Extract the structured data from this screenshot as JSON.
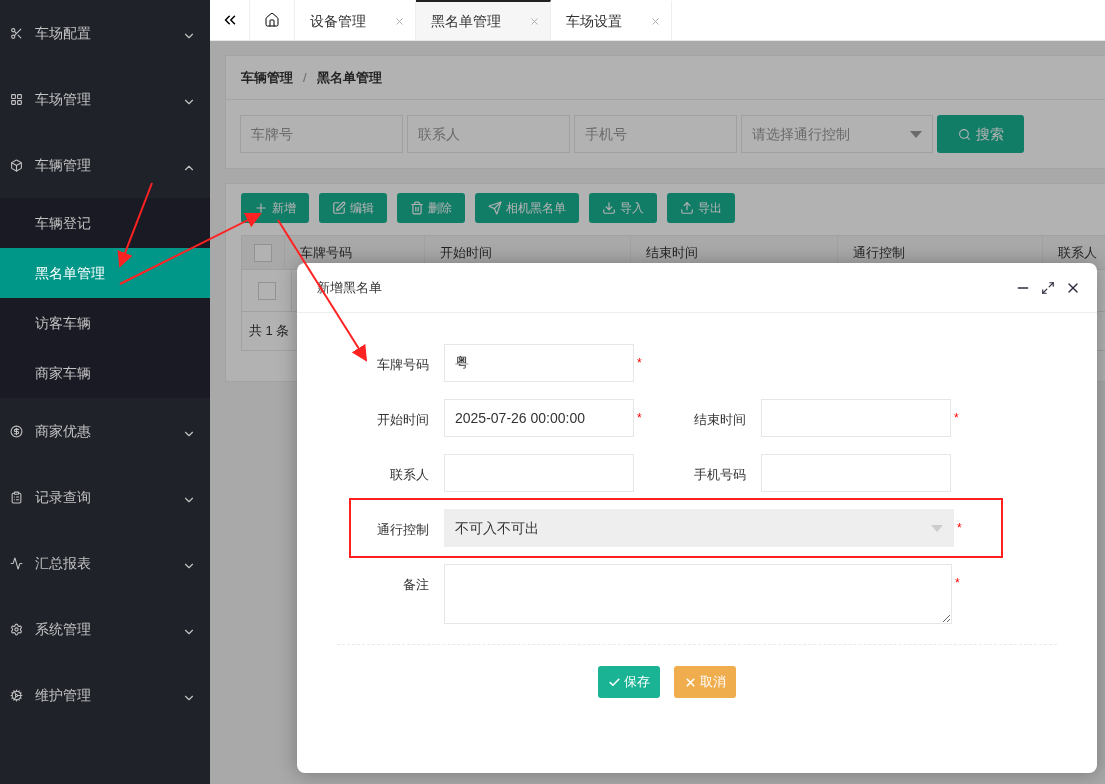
{
  "sidebar": {
    "items": [
      {
        "label": "车场配置",
        "expanded": false
      },
      {
        "label": "车场管理",
        "expanded": false
      },
      {
        "label": "车辆管理",
        "expanded": true,
        "children": [
          {
            "label": "车辆登记",
            "selected": false
          },
          {
            "label": "黑名单管理",
            "selected": true
          },
          {
            "label": "访客车辆",
            "selected": false
          },
          {
            "label": "商家车辆",
            "selected": false
          }
        ]
      },
      {
        "label": "商家优惠",
        "expanded": false
      },
      {
        "label": "记录查询",
        "expanded": false
      },
      {
        "label": "汇总报表",
        "expanded": false
      },
      {
        "label": "系统管理",
        "expanded": false
      },
      {
        "label": "维护管理",
        "expanded": false
      }
    ]
  },
  "tabs": [
    {
      "label": "设备管理",
      "selected": false
    },
    {
      "label": "黑名单管理",
      "selected": true
    },
    {
      "label": "车场设置",
      "selected": false
    }
  ],
  "breadcrumb": {
    "items": [
      "车辆管理",
      "黑名单管理"
    ],
    "separator": "/"
  },
  "search": {
    "fields": [
      {
        "placeholder": "车牌号"
      },
      {
        "placeholder": "联系人"
      },
      {
        "placeholder": "手机号"
      }
    ],
    "select_placeholder": "请选择通行控制",
    "button": "搜索"
  },
  "toolbar": [
    "新增",
    "编辑",
    "删除",
    "相机黑名单",
    "导入",
    "导出"
  ],
  "table": {
    "columns": [
      "车牌号码",
      "开始时间",
      "结束时间",
      "通行控制",
      "联系人"
    ],
    "header_checked": false,
    "rows": [
      {
        "checked": false
      }
    ],
    "footer": "共 1 条"
  },
  "modal": {
    "title": "新增黑名单",
    "required_mark": "*",
    "rows": [
      [
        {
          "label": "车牌号码",
          "kind": "text",
          "value": "粤",
          "required": true
        }
      ],
      [
        {
          "label": "开始时间",
          "kind": "text",
          "value": "2025-07-26 00:00:00",
          "required": true
        },
        {
          "label": "结束时间",
          "kind": "text",
          "required": true
        }
      ],
      [
        {
          "label": "联系人",
          "kind": "text",
          "required": false
        },
        {
          "label": "手机号码",
          "kind": "text",
          "required": false
        }
      ],
      [
        {
          "label": "通行控制",
          "kind": "select",
          "value": "不可入不可出",
          "required": true,
          "highlighted": true
        }
      ],
      [
        {
          "label": "备注",
          "kind": "textarea",
          "required": true
        }
      ]
    ],
    "buttons": [
      {
        "label": "保存",
        "kind": "primary"
      },
      {
        "label": "取消",
        "kind": "warning"
      }
    ]
  }
}
